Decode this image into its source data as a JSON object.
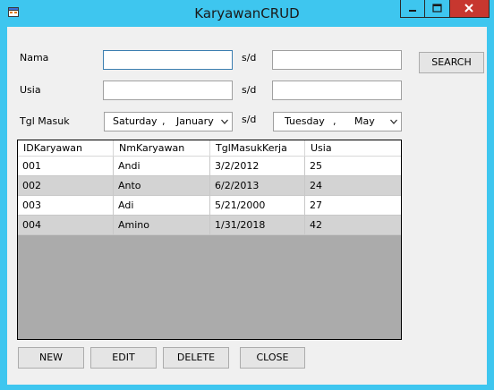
{
  "window": {
    "title": "KaryawanCRUD",
    "controls": {
      "minimize": "minimize-icon",
      "maximize": "maximize-icon",
      "close": "close-icon"
    }
  },
  "form": {
    "nama_label": "Nama",
    "usia_label": "Usia",
    "tgl_label": "Tgl Masuk",
    "sd_label": "s/d",
    "nama_from": "",
    "nama_to": "",
    "usia_from": "",
    "usia_to": "",
    "tgl_from": {
      "day": "Saturday",
      "sep": ",",
      "month": "January"
    },
    "tgl_to": {
      "day": "Tuesday",
      "sep": ",",
      "month": "May"
    },
    "search_label": "SEARCH"
  },
  "grid": {
    "columns": [
      "IDKaryawan",
      "NmKaryawan",
      "TglMasukKerja",
      "Usia"
    ],
    "rows": [
      [
        "001",
        "Andi",
        "3/2/2012",
        "25"
      ],
      [
        "002",
        "Anto",
        "6/2/2013",
        "24"
      ],
      [
        "003",
        "Adi",
        "5/21/2000",
        "27"
      ],
      [
        "004",
        "Amino",
        "1/31/2018",
        "42"
      ]
    ]
  },
  "buttons": {
    "new": "NEW",
    "edit": "EDIT",
    "delete": "DELETE",
    "close": "CLOSE"
  },
  "colors": {
    "titlebar": "#3ec6ef",
    "close_button": "#c7372f",
    "grid_background": "#ababab",
    "row_alt": "#d3d3d3"
  }
}
